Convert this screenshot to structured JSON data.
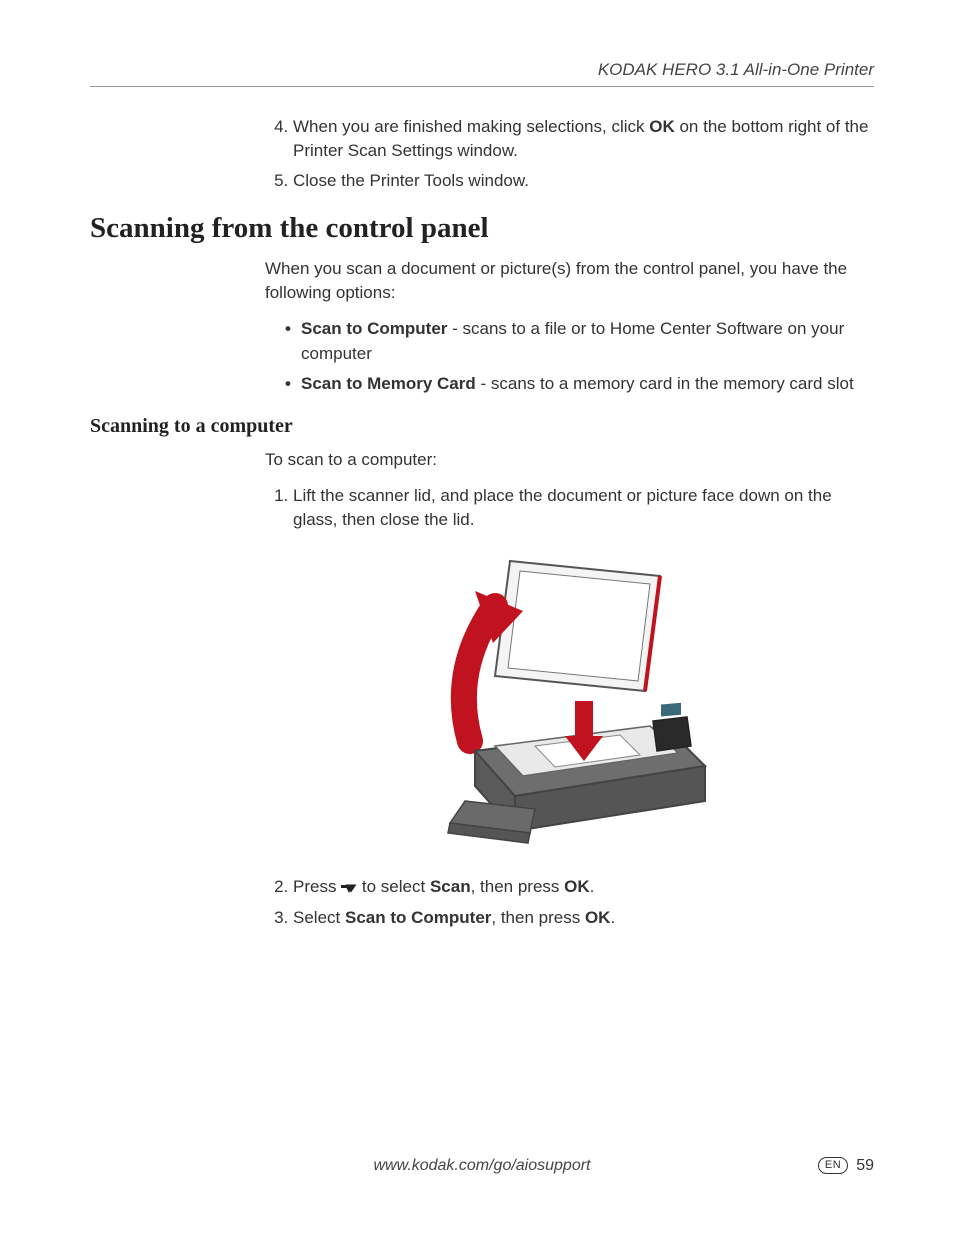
{
  "header": {
    "product_title": "KODAK HERO 3.1 All-in-One Printer"
  },
  "top_steps": {
    "start": 4,
    "items": [
      {
        "pre": "When you are finished making selections, click ",
        "bold": "OK",
        "post": " on the bottom right of the Printer Scan Settings window."
      },
      {
        "pre": "Close the Printer Tools window.",
        "bold": "",
        "post": ""
      }
    ]
  },
  "section": {
    "title": "Scanning from the control panel",
    "intro": "When you scan a document or picture(s) from the control panel, you have the following options:",
    "bullets": [
      {
        "bold": "Scan to Computer",
        "post": " - scans to a file or to Home Center Software on your computer"
      },
      {
        "bold": "Scan to Memory Card",
        "post": " - scans to a memory card in the memory card slot"
      }
    ]
  },
  "subsection": {
    "title": "Scanning to a computer",
    "intro": "To scan to a computer:",
    "steps": [
      {
        "pre": "Lift the scanner lid, and place the document or picture face down on the glass, then close the lid."
      },
      {
        "pre": "Press ",
        "icon": "down-arrow",
        "mid": " to select ",
        "bold1": "Scan",
        "mid2": ", then press ",
        "bold2": "OK",
        "post": "."
      },
      {
        "pre": "Select ",
        "bold1": "Scan to Computer",
        "mid2": ", then press ",
        "bold2": "OK",
        "post": "."
      }
    ]
  },
  "footer": {
    "url": "www.kodak.com/go/aiosupport",
    "lang": "EN",
    "page": "59"
  }
}
